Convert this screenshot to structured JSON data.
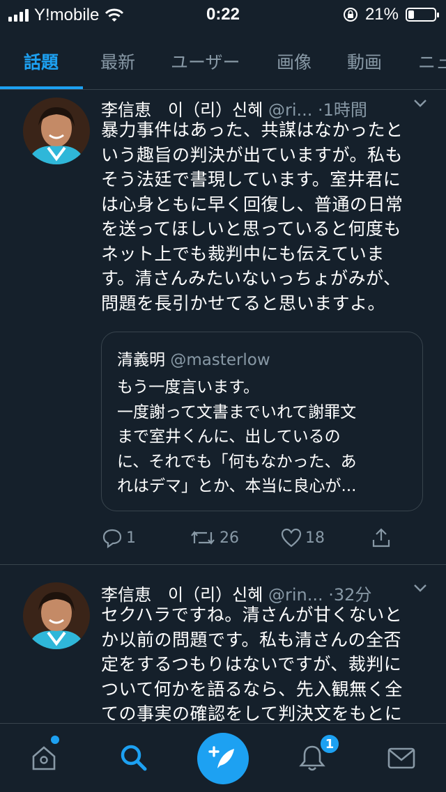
{
  "status_bar": {
    "carrier": "Y!mobile",
    "time": "0:22",
    "battery": "21%",
    "battery_level": 0.21
  },
  "tabs": [
    {
      "label": "話題",
      "active": true
    },
    {
      "label": "最新"
    },
    {
      "label": "ユーザー"
    },
    {
      "label": "画像"
    },
    {
      "label": "動画"
    },
    {
      "label": "ニュ"
    }
  ],
  "tweets": [
    {
      "name": "李信恵　이（리）신혜",
      "handle": "@ri...",
      "time": "·1時間",
      "lines": [
        "暴力事件はあった、共謀はなかったと",
        "いう趣旨の判決が出ていますが。私も",
        "そう法廷で書現しています。室井君に",
        "は心身ともに早く回復し、普通の日常",
        "を送ってほしいと思っていると何度も",
        "ネット上でも裁判中にも伝えていま",
        "す。清さんみたいないっちょがみが、",
        "問題を長引かせてると思いますよ。"
      ],
      "quote": {
        "name": "清義明",
        "handle": "@masterlow",
        "lines": [
          "もう一度言います。",
          "一度謝って文書までいれて謝罪文",
          "まで室井くんに、出しているの",
          "に、それでも「何もなかった、あ",
          "れはデマ」とか、本当に良心が..."
        ]
      },
      "replies": "1",
      "retweets": "26",
      "likes": "18"
    },
    {
      "name": "李信恵　이（리）신혜",
      "handle": "@rin...",
      "time": "·32分",
      "lines": [
        "セクハラですね。清さんが甘くないと",
        "か以前の問題です。私も清さんの全否",
        "定をするつもりはないですが、裁判に",
        "ついて何かを語るなら、先入観無く全",
        "ての事実の確認をして判決文をもとに"
      ]
    }
  ],
  "bottom_nav": {
    "notification_count": "1"
  },
  "colors": {
    "background": "#15202b",
    "accent": "#1da1f2",
    "muted": "#8899a6",
    "border": "#38444d"
  },
  "icons": [
    "signal-icon",
    "wifi-icon",
    "orientation-lock-icon",
    "battery-icon",
    "chevron-down-icon",
    "reply-icon",
    "retweet-icon",
    "like-icon",
    "share-icon",
    "home-icon",
    "search-icon",
    "compose-icon",
    "notifications-icon",
    "messages-icon"
  ]
}
